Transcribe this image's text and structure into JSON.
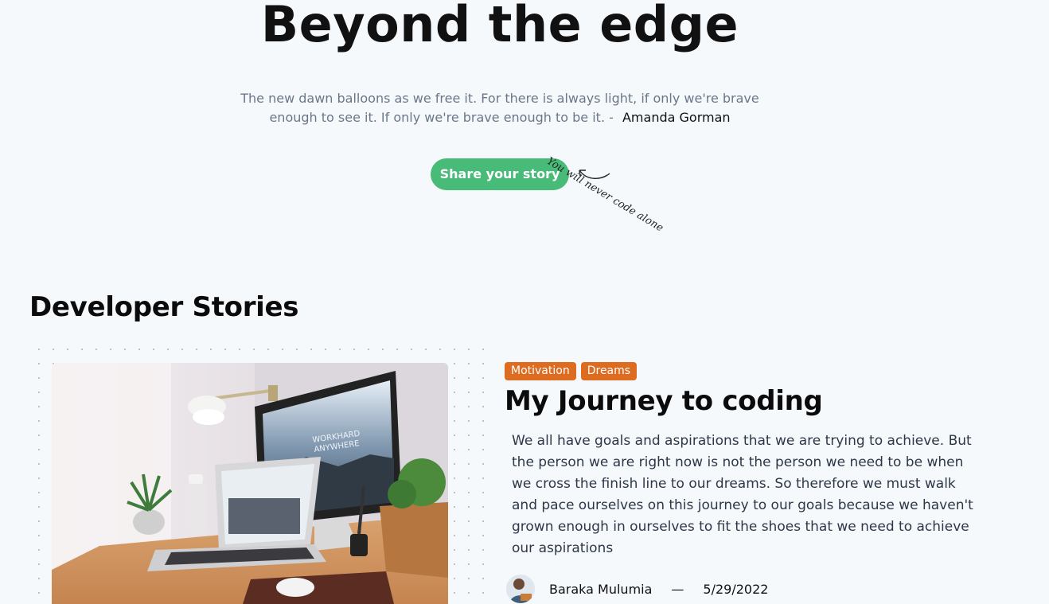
{
  "hero": {
    "title": "Beyond the edge",
    "quote": "The new dawn balloons as we free it. For there is always light, if only we're brave enough to see it. If only we're brave enough to be it. -",
    "quote_author": "Amanda Gorman",
    "cta_label": "Share your story",
    "scribble": "You will never code alone"
  },
  "stories": {
    "section_title": "Developer Stories",
    "featured": {
      "tags": [
        "Motivation",
        "Dreams"
      ],
      "title": "My Journey to coding",
      "body": "We all have goals and aspirations that we are trying to achieve. But the person we are right now is not the person we need to be when we cross the finish line to our dreams. So therefore we must walk and pace ourselves on this journey to our goals because we haven't grown enough in ourselves to fit the shoes that we need to achieve our aspirations",
      "author": "Baraka Mulumia",
      "date": "5/29/2022",
      "image_text_line1": "WORKHARD",
      "image_text_line2": "ANYWHERE"
    }
  },
  "colors": {
    "accent_green": "#48bb78",
    "tag_orange": "#dd6b20",
    "background": "#f6f9fc"
  }
}
